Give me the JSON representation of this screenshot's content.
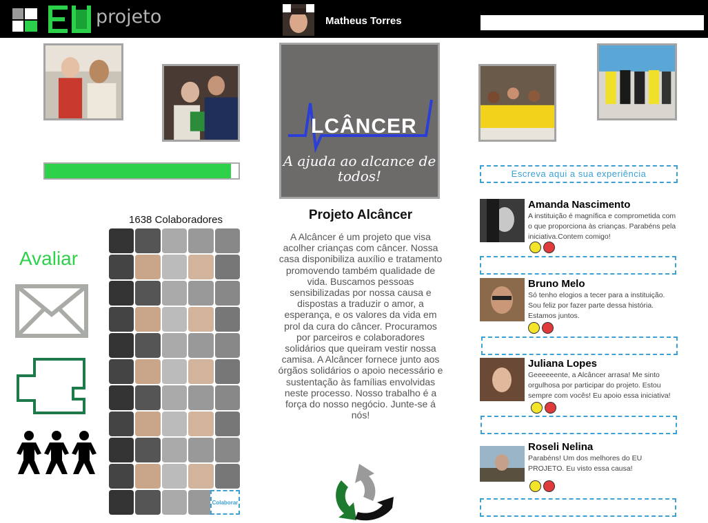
{
  "header": {
    "logo_text": "projeto",
    "logo_badge": "EU",
    "user_name": "Matheus Torres",
    "search_value": ""
  },
  "project": {
    "brand": "LCÂNCER",
    "tagline": "A ajuda ao alcance de todos!",
    "title": "Projeto Alcâncer",
    "description": "A Alcâncer é um projeto que visa acolher crianças com câncer. Nossa casa disponibiliza auxílio e tratamento promovendo também qualidade de vida. Buscamos pessoas sensibilizadas por nossa causa e dispostas a traduzir o amor, a esperança, e os valores da vida em prol da cura do câncer. Procuramos por parceiros e colaboradores solidários que queiram vestir nossa camisa. A Alcâncer fornece junto aos órgãos solidários o apoio necessário e sustentação às famílias envolvidas neste processo. Nosso trabalho é a força do nosso negócio. Junte-se á nós!",
    "progress": 0.96
  },
  "left": {
    "collaborators": "1638 Colaboradores",
    "collab_button": "Colaborar",
    "rate_label": "Avaliar"
  },
  "experience": {
    "placeholder": "Escreva aqui a sua experiência"
  },
  "comments": [
    {
      "name": "Amanda Nascimento",
      "text": "A instituição é magnífica e comprometida com o que proporciona às crianças. Parabéns pela iniciativa.Contem comigo!"
    },
    {
      "name": "Bruno Melo",
      "text": "Só tenho elogios a tecer para a instituição. Sou feliz por fazer parte dessa história. Estamos juntos."
    },
    {
      "name": "Juliana Lopes",
      "text": "Geeeeeente, a Alcâncer arrasa! Me sinto orgulhosa por participar do projeto. Estou sempre com vocês! Eu apoio essa iniciativa!"
    },
    {
      "name": "Roseli Nelina",
      "text": "Parabéns! Um dos melhores do EU PROJETO. Eu visto essa causa!"
    }
  ],
  "colors": {
    "accent_green": "#2ed24a",
    "accent_blue": "#3aa0d6",
    "dark_green": "#1e7a4a"
  }
}
